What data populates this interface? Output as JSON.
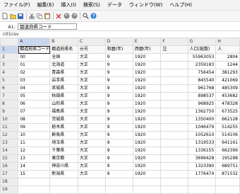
{
  "menu": [
    "ファイル(F)",
    "編集(E)",
    "挿入(I)",
    "検索(S)",
    "データ",
    "ウィンドウ(W)",
    "ヘルプ(H)"
  ],
  "toolbar": {
    "icons": [
      "new-file-icon",
      "open-folder-icon",
      "save-icon",
      "cut-icon",
      "copy-icon",
      "paste-icon",
      "delete-icon",
      "undo-icon",
      "redo-icon",
      "find-icon",
      "help-icon"
    ]
  },
  "formula_bar": {
    "cell_ref": "A1:",
    "value": "都道府県コード"
  },
  "sheet_name": "c01csv",
  "columns": [
    "A",
    "B",
    "C",
    "D",
    "E",
    "F",
    "G",
    "H"
  ],
  "row_numbers": [
    "1",
    "2",
    "3",
    "4",
    "5",
    "6",
    "7",
    "8",
    "9",
    "10",
    "11",
    "12",
    "13",
    "14",
    "15",
    "16",
    "17",
    "18",
    "19"
  ],
  "rows": [
    [
      "都道府県コード",
      "都道府県名",
      "元号",
      "和暦(年)",
      "西暦(年)",
      "注",
      "人口(総数)",
      "人"
    ],
    [
      "00",
      "全国",
      "大正",
      "9",
      "1920",
      "",
      "55963053",
      "2804"
    ],
    [
      "01",
      "北海道",
      "大正",
      "9",
      "1920",
      "",
      "2359183",
      "1244"
    ],
    [
      "02",
      "青森県",
      "大正",
      "9",
      "1920",
      "",
      "756454",
      "381293"
    ],
    [
      "03",
      "岩手県",
      "大正",
      "9",
      "1920",
      "",
      "845540",
      "421069"
    ],
    [
      "04",
      "宮城県",
      "大正",
      "9",
      "1920",
      "",
      "961768",
      "485309"
    ],
    [
      "05",
      "秋田県",
      "大正",
      "9",
      "1920",
      "",
      "898537",
      "453682"
    ],
    [
      "06",
      "山形県",
      "大正",
      "9",
      "1920",
      "",
      "968925",
      "478328"
    ],
    [
      "07",
      "福島県",
      "大正",
      "9",
      "1920",
      "",
      "1362750",
      "673525"
    ],
    [
      "08",
      "茨城県",
      "大正",
      "9",
      "1920",
      "",
      "1350400",
      "662128"
    ],
    [
      "09",
      "栃木県",
      "大正",
      "9",
      "1920",
      "",
      "1046479",
      "514255"
    ],
    [
      "10",
      "群馬県",
      "大正",
      "9",
      "1920",
      "",
      "1052610",
      "514106"
    ],
    [
      "11",
      "埼玉県",
      "大正",
      "9",
      "1920",
      "",
      "1319533",
      "641161"
    ],
    [
      "12",
      "千葉県",
      "大正",
      "9",
      "1920",
      "",
      "1336155",
      "662399"
    ],
    [
      "13",
      "東京都",
      "大正",
      "9",
      "1920",
      "",
      "3699428",
      "195298"
    ],
    [
      "14",
      "神奈川県",
      "大正",
      "9",
      "1920",
      "",
      "1323390",
      "689751"
    ],
    [
      "15",
      "新潟県",
      "大正",
      "9",
      "1920",
      "",
      "1776474",
      "871532"
    ]
  ]
}
